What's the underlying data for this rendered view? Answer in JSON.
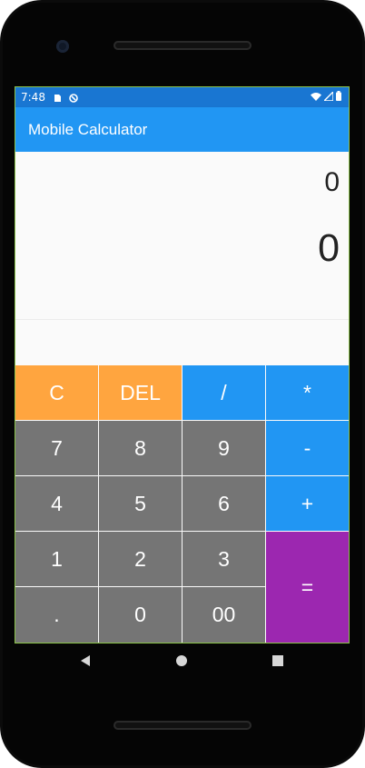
{
  "status": {
    "time": "7:48"
  },
  "app": {
    "title": "Mobile Calculator",
    "colors": {
      "status_bar": "#1976d2",
      "app_bar": "#2196f3",
      "operator_key": "#2196f3",
      "clear_key": "#ffa53f",
      "number_key": "#757575",
      "equals_key": "#9c27b0"
    }
  },
  "display": {
    "expression": "0",
    "result": "0"
  },
  "keys": {
    "clear": "C",
    "delete": "DEL",
    "divide": "/",
    "multiply": "*",
    "seven": "7",
    "eight": "8",
    "nine": "9",
    "minus": "-",
    "four": "4",
    "five": "5",
    "six": "6",
    "plus": "+",
    "one": "1",
    "two": "2",
    "three": "3",
    "equals": "=",
    "dot": ".",
    "zero": "0",
    "double_zero": "00"
  },
  "icons": {
    "status_left": [
      "sd-card-icon",
      "sync-icon"
    ],
    "status_right": [
      "wifi-icon",
      "signal-icon",
      "battery-icon"
    ],
    "nav": [
      "back-icon",
      "home-icon",
      "recents-icon"
    ]
  }
}
